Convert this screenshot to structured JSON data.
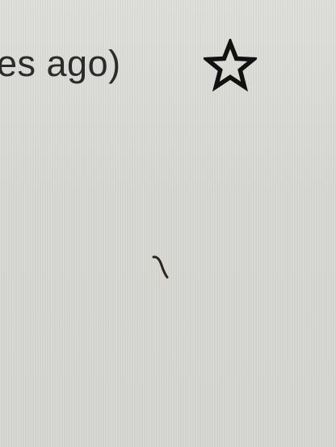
{
  "email_header": {
    "timestamp_text": "es ago)",
    "star_icon": "star-outline-icon"
  },
  "colors": {
    "background": "#d8d8d5",
    "text": "#2b2b2b",
    "icon": "#111111"
  }
}
